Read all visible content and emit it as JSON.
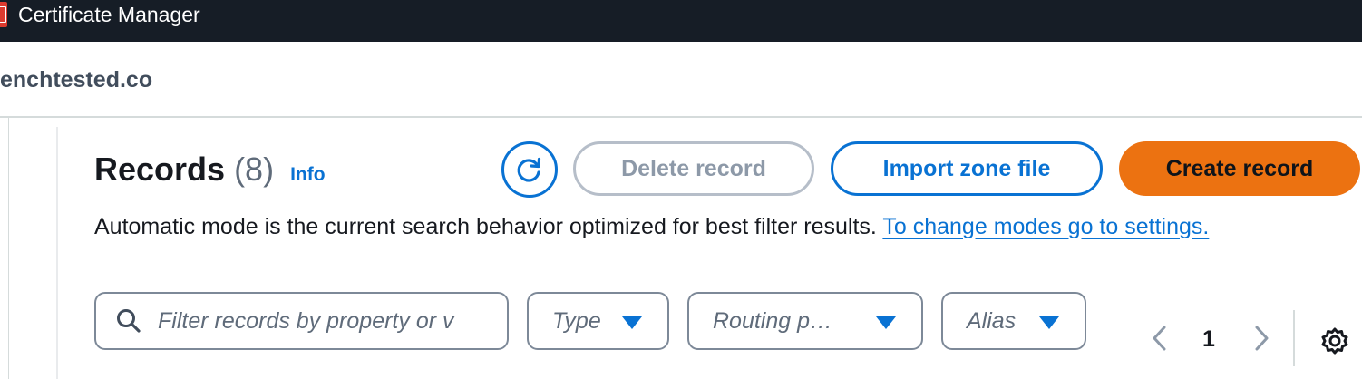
{
  "browser": {
    "tab_title": "Certificate Manager"
  },
  "page": {
    "domain_title": "enchtested.co"
  },
  "records": {
    "title": "Records",
    "count": "(8)",
    "info_link": "Info",
    "buttons": {
      "refresh_icon": "refresh-icon",
      "delete": "Delete record",
      "import": "Import zone file",
      "create": "Create record"
    },
    "mode_text": "Automatic mode is the current search behavior optimized for best filter results. ",
    "mode_link": "To change modes go to settings.",
    "filter": {
      "placeholder": "Filter records by property or v"
    },
    "dropdowns": {
      "type": "Type",
      "routing": "Routing p…",
      "alias": "Alias"
    },
    "pagination": {
      "current_page": "1"
    }
  },
  "colors": {
    "accent": "#0972d3",
    "primary_button": "#ec7211",
    "topbar": "#161d26",
    "disabled": "#8d99a8"
  }
}
